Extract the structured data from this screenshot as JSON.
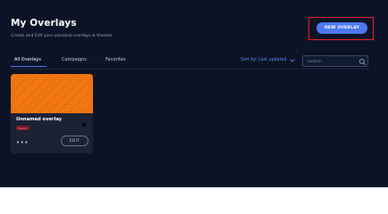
{
  "header": {
    "title": "My Overlays",
    "subtitle": "Create and Edit your personal overlays & themes",
    "new_overlay_label": "NEW OVERLAY",
    "highlight_color": "#e0232c",
    "accent_color": "#4d78f0"
  },
  "tabs": [
    {
      "label": "All Overlays",
      "active": true
    },
    {
      "label": "Campaigns",
      "active": false
    },
    {
      "label": "Favorites",
      "active": false
    }
  ],
  "sort": {
    "label": "Sort by: Last updated",
    "icon": "chevron-down-icon"
  },
  "search": {
    "placeholder": "Search",
    "value": "",
    "icon": "search-icon"
  },
  "overlays": [
    {
      "name": "Unnamed overlay",
      "badge": "BASIC",
      "menu_label": "•••",
      "edit_label": "EDIT"
    }
  ]
}
